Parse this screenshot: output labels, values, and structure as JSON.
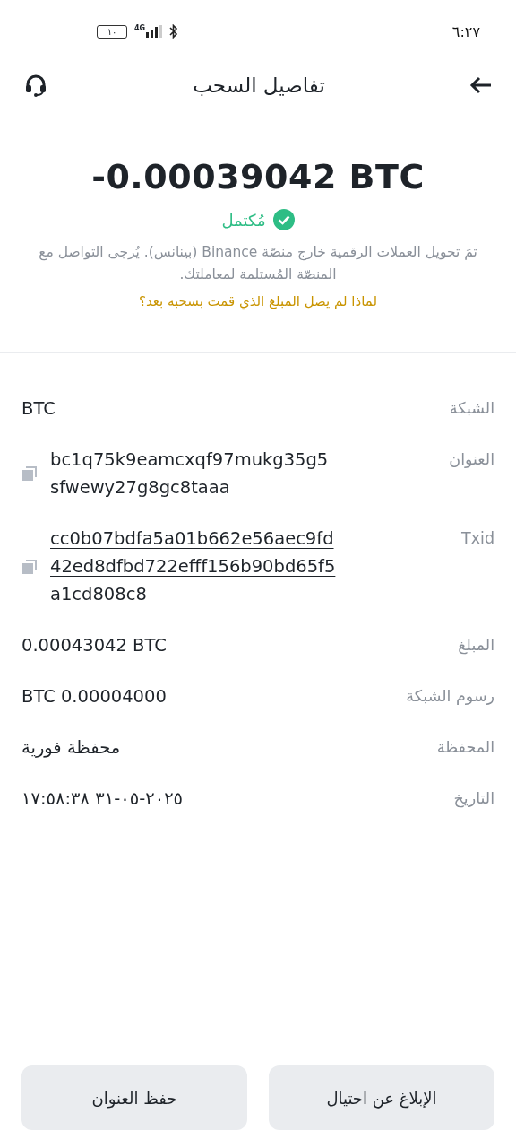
{
  "status_bar": {
    "time": "٦:٢٧",
    "battery": "١٠",
    "network": "4G"
  },
  "header": {
    "title": "تفاصيل السحب"
  },
  "summary": {
    "amount": "-0.00039042 BTC",
    "status": "مُكتمل",
    "description": "تمَ تحويل العملات الرقمية خارج منصّة Binance (بينانس). يُرجى التواصل مع المنصّة المُستلمة لمعاملتك.",
    "help_link": "لماذا لم يصل المبلغ الذي قمت بسحبه بعد؟"
  },
  "details": [
    {
      "label": "الشبكة",
      "value_lines": [
        "BTC"
      ],
      "kind": "plain"
    },
    {
      "label": "العنوان",
      "value_lines": [
        "bc1q75k9eamcxqf97mukg35g5",
        "sfwewy27g8gc8taaa"
      ],
      "kind": "copy"
    },
    {
      "label": "Txid",
      "value_lines": [
        "cc0b07bdfa5a01b662e56aec9fd",
        "42ed8dfbd722efff156b90bd65f5",
        "a1cd808c8"
      ],
      "kind": "link"
    },
    {
      "label": "المبلغ",
      "value_lines": [
        "0.00043042 BTC"
      ],
      "kind": "plain"
    },
    {
      "label": "رسوم الشبكة",
      "value_lines": [
        "BTC 0.00004000"
      ],
      "kind": "plain"
    },
    {
      "label": "المحفظة",
      "value_lines": [
        "محفظة فورية"
      ],
      "kind": "arabic"
    },
    {
      "label": "التاريخ",
      "value_lines": [
        "٢٠٢٥-٠٥-٣١ ١٧:٥٨:٣٨"
      ],
      "kind": "arabic"
    }
  ],
  "buttons": [
    "الإبلاغ عن احتيال",
    "حفظ العنوان"
  ]
}
